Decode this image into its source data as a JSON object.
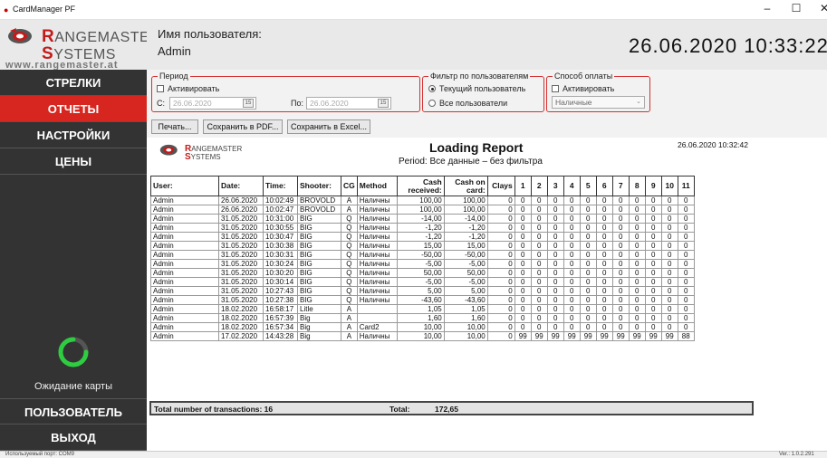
{
  "window": {
    "title": "CardManager PF"
  },
  "logo": {
    "line1_cap": "R",
    "line1_rest": "ANGEMASTER",
    "line2_cap": "S",
    "line2_rest": "YSTEMS",
    "url": "www.rangemaster.at"
  },
  "header": {
    "user_label": "Имя пользователя:",
    "user_name": "Admin",
    "datetime": "26.06.2020  10:33:22"
  },
  "nav": [
    {
      "label": "СТРЕЛКИ",
      "active": false
    },
    {
      "label": "ОТЧЕТЫ",
      "active": true
    },
    {
      "label": "НАСТРОЙКИ",
      "active": false
    },
    {
      "label": "ЦЕНЫ",
      "active": false
    }
  ],
  "nav_bottom": [
    {
      "label": "ПОЛЬЗОВАТЕЛЬ"
    },
    {
      "label": "ВЫХОД"
    }
  ],
  "card_status": "Ожидание карты",
  "period": {
    "legend": "Период",
    "activate_label": "Активировать",
    "from_label": "С:",
    "from_value": "26.06.2020",
    "to_label": "По:",
    "to_value": "26.06.2020",
    "cal_text": "15"
  },
  "user_filter": {
    "legend": "Фильтр по пользователям",
    "options": [
      "Текущий пользователь",
      "Все пользователи"
    ],
    "selected": 0
  },
  "payment": {
    "legend": "Способ оплаты",
    "activate_label": "Активировать",
    "selected": "Наличные"
  },
  "toolbar": {
    "print": "Печать...",
    "save_pdf": "Сохранить в PDF...",
    "save_excel": "Сохранить в Excel..."
  },
  "report": {
    "title": "Loading Report",
    "period": "Period: Все данные – без фильтра",
    "date": "26.06.2020 10:32:42",
    "logo_l1_cap": "R",
    "logo_l1_rest": "ANGEMASTER",
    "logo_l2_cap": "S",
    "logo_l2_rest": "YSTEMS"
  },
  "table": {
    "columns": [
      "User:",
      "Date:",
      "Time:",
      "Shooter:",
      "CG",
      "Method",
      "Cash received:",
      "Cash on card:",
      "Clays",
      "1",
      "2",
      "3",
      "4",
      "5",
      "6",
      "7",
      "8",
      "9",
      "10",
      "11"
    ],
    "rows": [
      [
        "Admin",
        "26.06.2020",
        "10:02:49",
        "BROVOLD",
        "A",
        "Наличны",
        "100,00",
        "100,00",
        "0",
        "0",
        "0",
        "0",
        "0",
        "0",
        "0",
        "0",
        "0",
        "0",
        "0",
        "0"
      ],
      [
        "Admin",
        "26.06.2020",
        "10:02:47",
        "BROVOLD",
        "A",
        "Наличны",
        "100,00",
        "100,00",
        "0",
        "0",
        "0",
        "0",
        "0",
        "0",
        "0",
        "0",
        "0",
        "0",
        "0",
        "0"
      ],
      [
        "Admin",
        "31.05.2020",
        "10:31:00",
        "BIG",
        "Q",
        "Наличны",
        "-14,00",
        "-14,00",
        "0",
        "0",
        "0",
        "0",
        "0",
        "0",
        "0",
        "0",
        "0",
        "0",
        "0",
        "0"
      ],
      [
        "Admin",
        "31.05.2020",
        "10:30:55",
        "BIG",
        "Q",
        "Наличны",
        "-1,20",
        "-1,20",
        "0",
        "0",
        "0",
        "0",
        "0",
        "0",
        "0",
        "0",
        "0",
        "0",
        "0",
        "0"
      ],
      [
        "Admin",
        "31.05.2020",
        "10:30:47",
        "BIG",
        "Q",
        "Наличны",
        "-1,20",
        "-1,20",
        "0",
        "0",
        "0",
        "0",
        "0",
        "0",
        "0",
        "0",
        "0",
        "0",
        "0",
        "0"
      ],
      [
        "Admin",
        "31.05.2020",
        "10:30:38",
        "BIG",
        "Q",
        "Наличны",
        "15,00",
        "15,00",
        "0",
        "0",
        "0",
        "0",
        "0",
        "0",
        "0",
        "0",
        "0",
        "0",
        "0",
        "0"
      ],
      [
        "Admin",
        "31.05.2020",
        "10:30:31",
        "BIG",
        "Q",
        "Наличны",
        "-50,00",
        "-50,00",
        "0",
        "0",
        "0",
        "0",
        "0",
        "0",
        "0",
        "0",
        "0",
        "0",
        "0",
        "0"
      ],
      [
        "Admin",
        "31.05.2020",
        "10:30:24",
        "BIG",
        "Q",
        "Наличны",
        "-5,00",
        "-5,00",
        "0",
        "0",
        "0",
        "0",
        "0",
        "0",
        "0",
        "0",
        "0",
        "0",
        "0",
        "0"
      ],
      [
        "Admin",
        "31.05.2020",
        "10:30:20",
        "BIG",
        "Q",
        "Наличны",
        "50,00",
        "50,00",
        "0",
        "0",
        "0",
        "0",
        "0",
        "0",
        "0",
        "0",
        "0",
        "0",
        "0",
        "0"
      ],
      [
        "Admin",
        "31.05.2020",
        "10:30:14",
        "BIG",
        "Q",
        "Наличны",
        "-5,00",
        "-5,00",
        "0",
        "0",
        "0",
        "0",
        "0",
        "0",
        "0",
        "0",
        "0",
        "0",
        "0",
        "0"
      ],
      [
        "Admin",
        "31.05.2020",
        "10:27:43",
        "BIG",
        "Q",
        "Наличны",
        "5,00",
        "5,00",
        "0",
        "0",
        "0",
        "0",
        "0",
        "0",
        "0",
        "0",
        "0",
        "0",
        "0",
        "0"
      ],
      [
        "Admin",
        "31.05.2020",
        "10:27:38",
        "BIG",
        "Q",
        "Наличны",
        "-43,60",
        "-43,60",
        "0",
        "0",
        "0",
        "0",
        "0",
        "0",
        "0",
        "0",
        "0",
        "0",
        "0",
        "0"
      ],
      [
        "Admin",
        "18.02.2020",
        "16:58:17",
        "Litle",
        "A",
        "",
        "1,05",
        "1,05",
        "0",
        "0",
        "0",
        "0",
        "0",
        "0",
        "0",
        "0",
        "0",
        "0",
        "0",
        "0"
      ],
      [
        "Admin",
        "18.02.2020",
        "16:57:39",
        "Big",
        "A",
        "",
        "1,60",
        "1,60",
        "0",
        "0",
        "0",
        "0",
        "0",
        "0",
        "0",
        "0",
        "0",
        "0",
        "0",
        "0"
      ],
      [
        "Admin",
        "18.02.2020",
        "16:57:34",
        "Big",
        "A",
        "Card2",
        "10,00",
        "10,00",
        "0",
        "0",
        "0",
        "0",
        "0",
        "0",
        "0",
        "0",
        "0",
        "0",
        "0",
        "0"
      ],
      [
        "Admin",
        "17.02.2020",
        "14:43:28",
        "Big",
        "A",
        "Наличны",
        "10,00",
        "10,00",
        "0",
        "99",
        "99",
        "99",
        "99",
        "99",
        "99",
        "99",
        "99",
        "99",
        "99",
        "88"
      ]
    ]
  },
  "totals": {
    "count_label": "Total number of transactions: 16",
    "total_label": "Total:",
    "total_value": "172,65"
  },
  "statusbar": {
    "port": "Используемый порт: COM9",
    "version": "Ver.: 1.0.2.291"
  },
  "colors": {
    "accent": "#d7261f",
    "sidebar": "#333333",
    "spinner": "#2ecc40"
  },
  "icons": {
    "app": "app-icon",
    "spinner": "card-reader-spinner-icon",
    "calendar": "calendar-icon"
  }
}
